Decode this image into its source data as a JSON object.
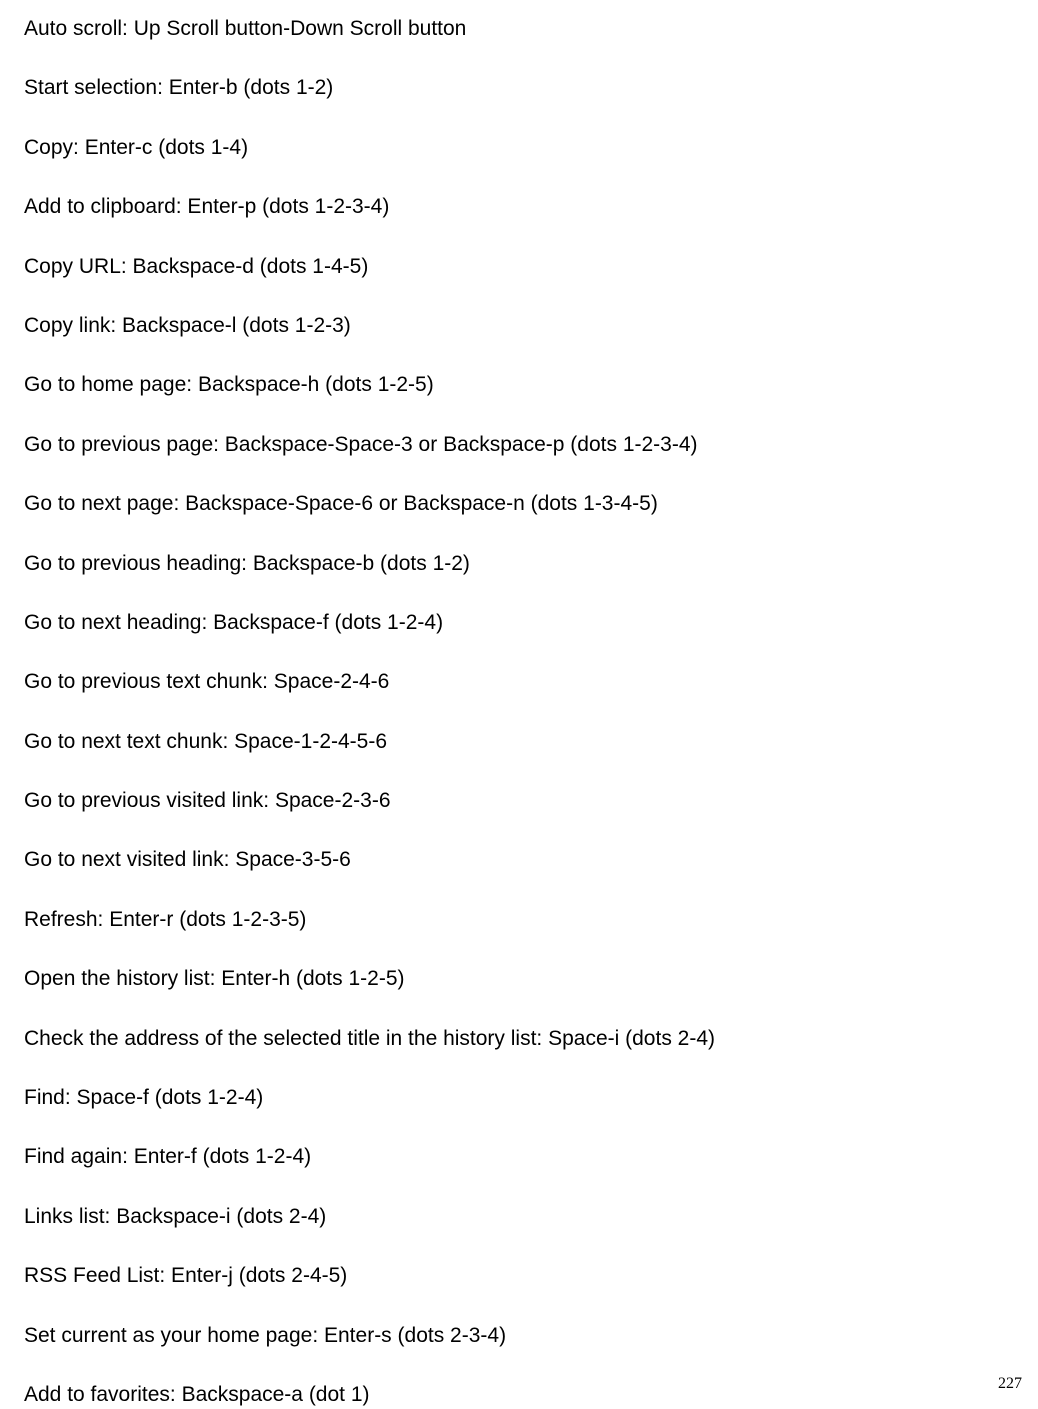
{
  "commands": [
    "Auto scroll: Up Scroll button-Down Scroll button",
    "Start selection: Enter-b (dots 1-2)",
    "Copy: Enter-c (dots 1-4)",
    "Add to clipboard: Enter-p (dots 1-2-3-4)",
    "Copy URL: Backspace-d (dots 1-4-5)",
    "Copy link: Backspace-l (dots 1-2-3)",
    "Go to home page: Backspace-h (dots 1-2-5)",
    "Go to previous page: Backspace-Space-3 or Backspace-p (dots 1-2-3-4)",
    "Go to next page: Backspace-Space-6 or Backspace-n (dots 1-3-4-5)",
    "Go to previous heading: Backspace-b (dots 1-2)",
    "Go to next heading: Backspace-f (dots 1-2-4)",
    "Go to previous text chunk: Space-2-4-6",
    "Go to next text chunk: Space-1-2-4-5-6",
    "Go to previous visited link: Space-2-3-6",
    "Go to next visited link: Space-3-5-6",
    "Refresh: Enter-r (dots 1-2-3-5)",
    "Open the history list: Enter-h (dots 1-2-5)",
    "Check the address of the selected title in the history list: Space-i (dots 2-4)",
    "Find: Space-f (dots 1-2-4)",
    "Find again: Enter-f (dots 1-2-4)",
    "Links list: Backspace-i (dots 2-4)",
    "RSS Feed List: Enter-j (dots 2-4-5)",
    "Set current as your home page: Enter-s (dots 2-3-4)",
    "Add to favorites: Backspace-a (dot 1)"
  ],
  "page_number": "227"
}
